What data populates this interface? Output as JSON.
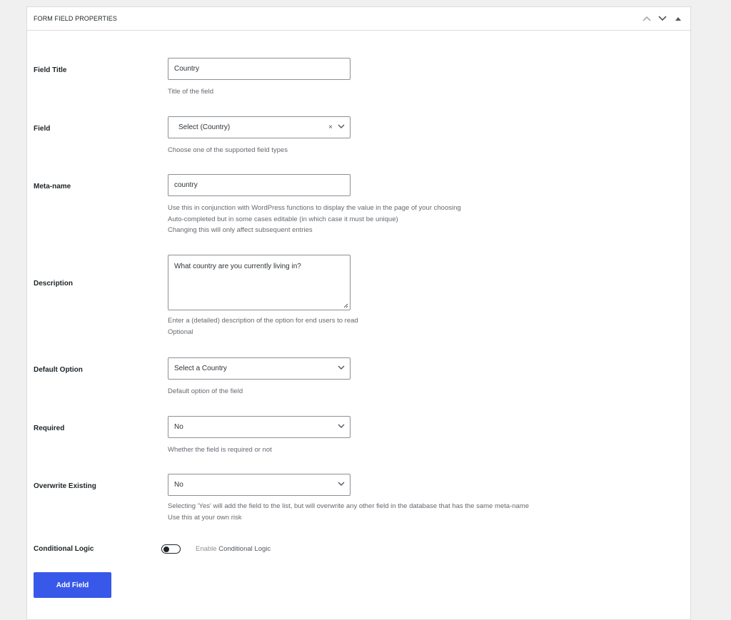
{
  "panel": {
    "title": "FORM FIELD PROPERTIES",
    "controls": [
      "move-up-icon",
      "move-down-icon",
      "toggle-panel-icon"
    ]
  },
  "fields": {
    "field_title": {
      "label": "Field Title",
      "value": "Country",
      "help": [
        "Title of the field"
      ]
    },
    "field": {
      "label": "Field",
      "value": "Select (Country)",
      "clear": "×",
      "help": [
        "Choose one of the supported field types"
      ]
    },
    "meta_name": {
      "label": "Meta-name",
      "value": "country",
      "help": [
        "Use this in conjunction with WordPress functions to display the value in the page of your choosing",
        "Auto-completed but in some cases editable (in which case it must be unique)",
        "Changing this will only affect subsequent entries"
      ]
    },
    "description": {
      "label": "Description",
      "value": "What country are you currently living in?",
      "help": [
        "Enter a (detailed) description of the option for end users to read",
        "Optional"
      ]
    },
    "default_option": {
      "label": "Default Option",
      "value": "Select a Country",
      "help": [
        "Default option of the field"
      ]
    },
    "required": {
      "label": "Required",
      "value": "No",
      "help": [
        "Whether the field is required or not"
      ]
    },
    "overwrite_existing": {
      "label": "Overwrite Existing",
      "value": "No",
      "help": [
        "Selecting 'Yes' will add the field to the list, but will overwrite any other field in the database that has the same meta-name",
        "Use this at your own risk"
      ]
    },
    "conditional_logic": {
      "label": "Conditional Logic",
      "toggle_prefix": "Enable",
      "toggle_text": "Conditional Logic",
      "enabled": false
    }
  },
  "actions": {
    "add_field_label": "Add Field"
  },
  "colors": {
    "primary_button": "#3858e9",
    "background": "#f0f0f1"
  }
}
